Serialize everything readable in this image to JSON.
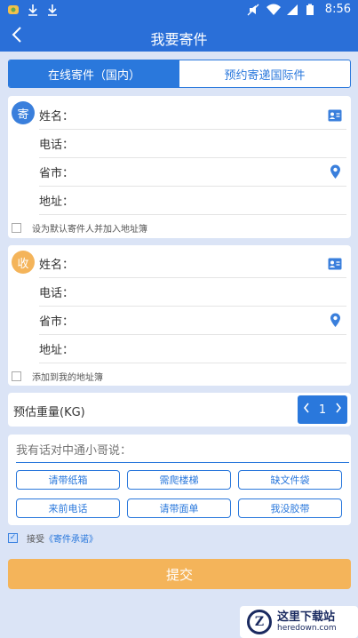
{
  "status_bar": {
    "time": "8:56"
  },
  "header": {
    "title": "我要寄件"
  },
  "tabs": [
    {
      "label": "在线寄件（国内）",
      "active": true
    },
    {
      "label": "预约寄递国际件",
      "active": false
    }
  ],
  "sender": {
    "badge": "寄",
    "badge_color": "#3a7fdc",
    "fields": [
      {
        "label": "姓名：",
        "value": "",
        "icon": "contact-card-icon"
      },
      {
        "label": "电话：",
        "value": ""
      },
      {
        "label": "省市：",
        "value": "",
        "icon": "location-pin-icon"
      },
      {
        "label": "地址：",
        "value": ""
      }
    ],
    "checkbox_label": "设为默认寄件人并加入地址簿",
    "checked": false
  },
  "receiver": {
    "badge": "收",
    "badge_color": "#f4b45a",
    "fields": [
      {
        "label": "姓名：",
        "value": "",
        "icon": "contact-card-icon"
      },
      {
        "label": "电话：",
        "value": ""
      },
      {
        "label": "省市：",
        "value": "",
        "icon": "location-pin-icon"
      },
      {
        "label": "地址：",
        "value": ""
      }
    ],
    "checkbox_label": "添加到我的地址簿",
    "checked": false
  },
  "weight": {
    "label": "预估重量(KG)",
    "value": "1"
  },
  "message": {
    "placeholder": "我有话对中通小哥说：",
    "chips": [
      "请带纸箱",
      "需爬楼梯",
      "缺文件袋",
      "来前电话",
      "请带面单",
      "我没胶带"
    ]
  },
  "agree": {
    "prefix": "接受",
    "link": "《寄件承诺》",
    "checked": true
  },
  "submit_label": "提交",
  "watermark": {
    "title": "这里下载站",
    "subtitle": "heredown.com"
  },
  "colors": {
    "primary": "#2a78dc",
    "accent": "#f4b45a",
    "background": "#dbe4f6"
  }
}
